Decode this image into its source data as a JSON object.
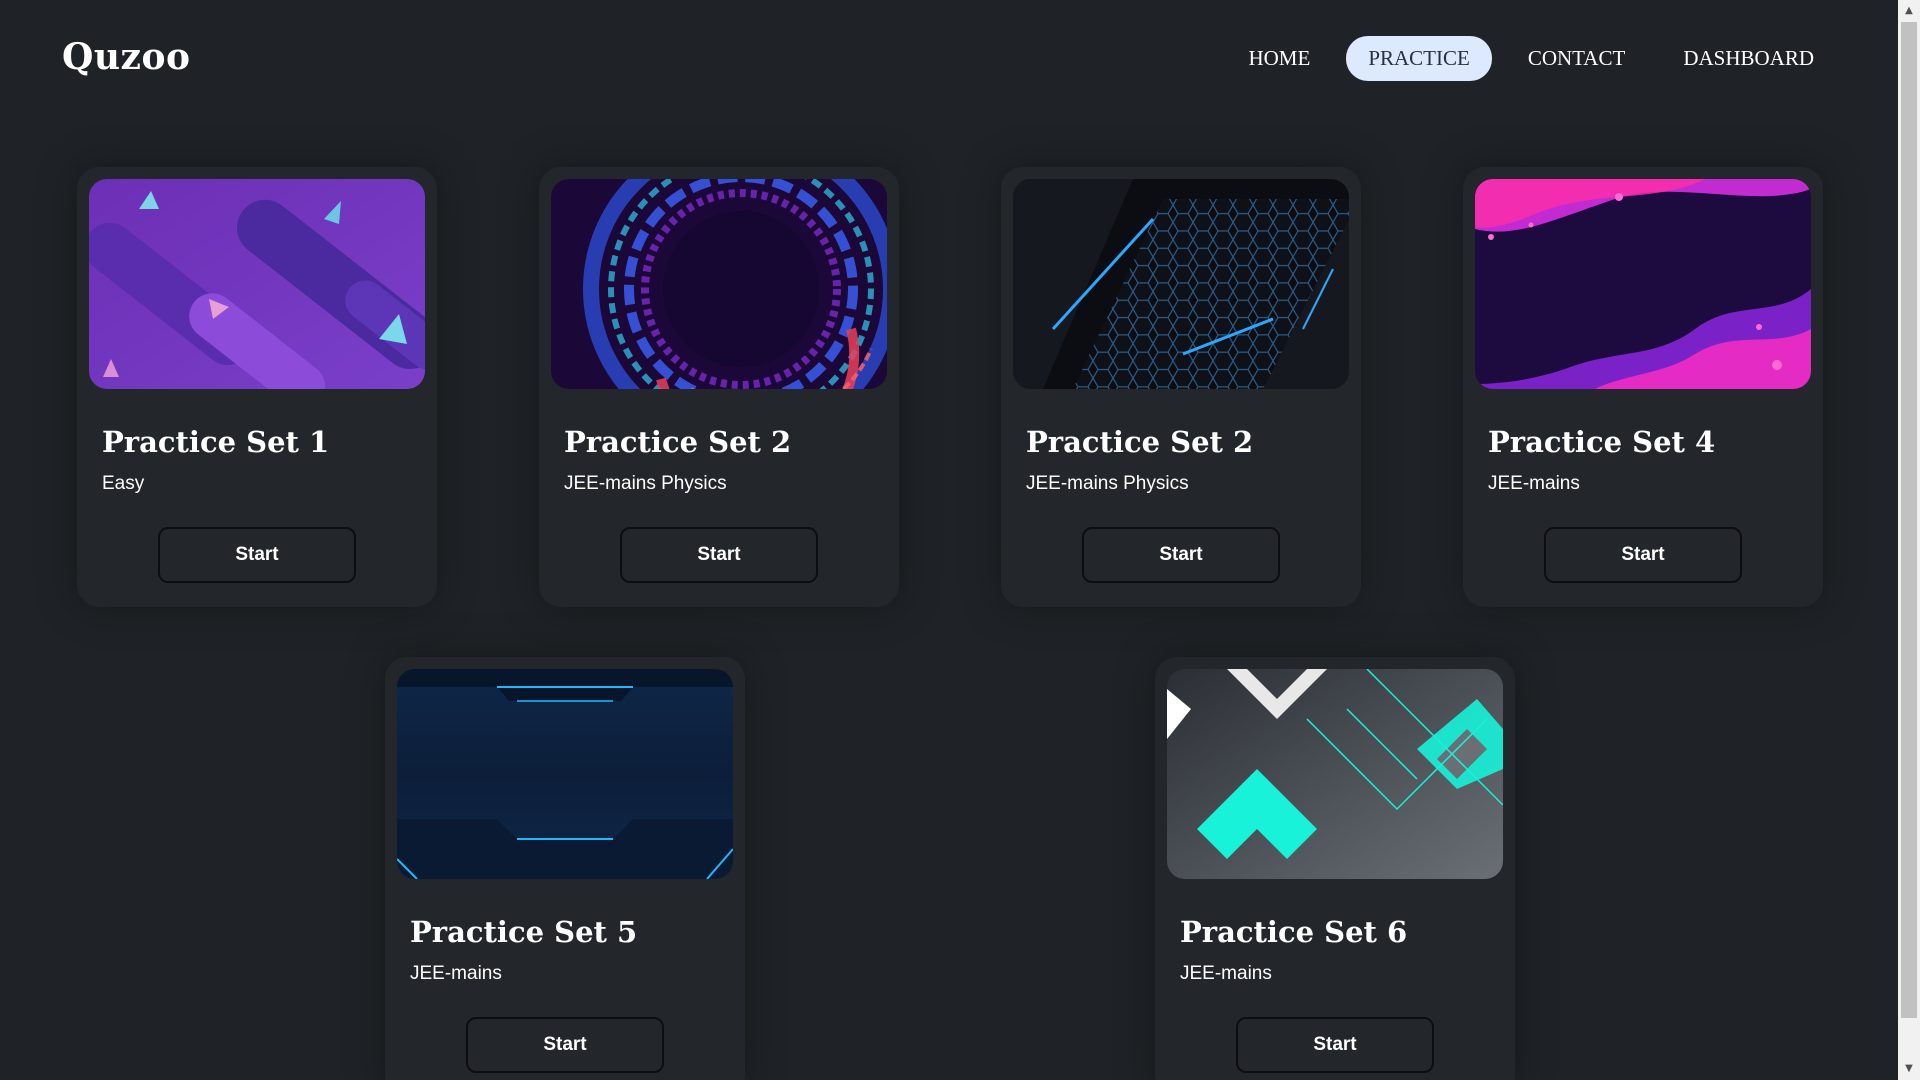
{
  "header": {
    "logo": "Quzoo",
    "nav": [
      {
        "label": "HOME",
        "active": false
      },
      {
        "label": "PRACTICE",
        "active": true
      },
      {
        "label": "CONTACT",
        "active": false
      },
      {
        "label": "DASHBOARD",
        "active": false
      }
    ]
  },
  "cards": [
    {
      "title": "Practice Set 1",
      "subtitle": "Easy",
      "button": "Start",
      "image": "purple-geometric-abstract"
    },
    {
      "title": "Practice Set 2",
      "subtitle": "JEE-mains Physics",
      "button": "Start",
      "image": "colorful-swirl-abstract"
    },
    {
      "title": "Practice Set 2",
      "subtitle": "JEE-mains Physics",
      "button": "Start",
      "image": "dark-hexagon-blue-abstract"
    },
    {
      "title": "Practice Set 4",
      "subtitle": "JEE-mains",
      "button": "Start",
      "image": "purple-pink-wave-abstract"
    },
    {
      "title": "Practice Set 5",
      "subtitle": "JEE-mains",
      "button": "Start",
      "image": "navy-tech-panel-abstract"
    },
    {
      "title": "Practice Set 6",
      "subtitle": "JEE-mains",
      "button": "Start",
      "image": "teal-grey-geometric-abstract"
    }
  ],
  "colors": {
    "background": "#1f2327",
    "card": "#23272b",
    "nav_active_bg": "#dce9ff",
    "text": "#ffffff"
  },
  "scrollbar": {
    "up_icon": "chevron-up-icon",
    "down_icon": "chevron-down-icon"
  }
}
